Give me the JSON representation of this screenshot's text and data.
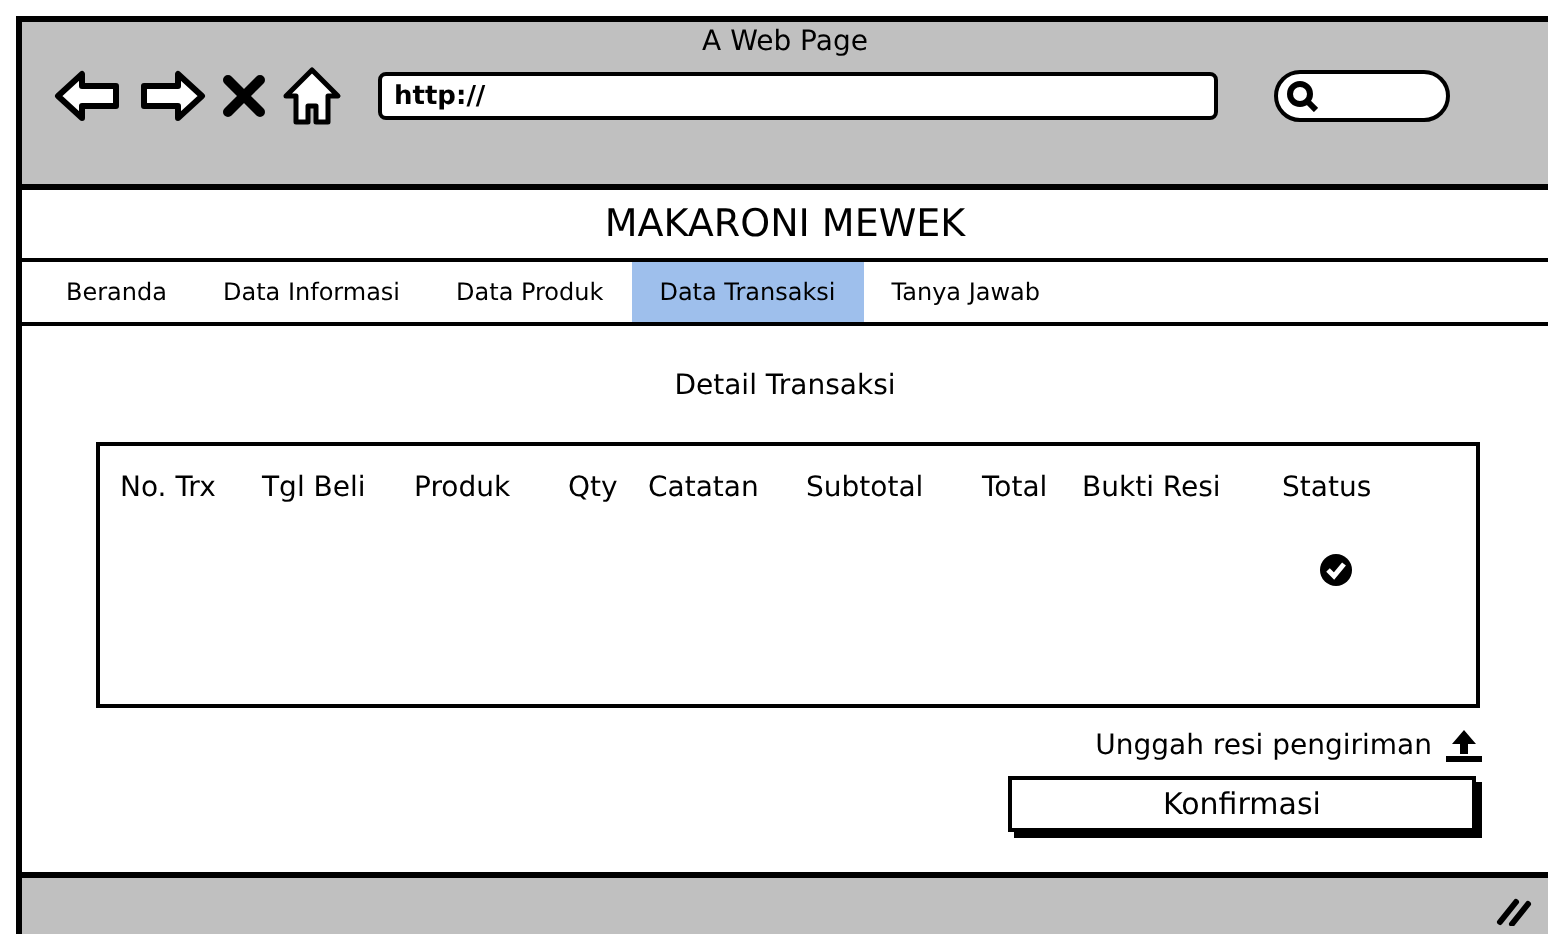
{
  "window": {
    "title": "A Web Page"
  },
  "browser": {
    "address": {
      "value": "http://"
    }
  },
  "site": {
    "title": "MAKARONI MEWEK"
  },
  "tabs": [
    {
      "label": "Beranda",
      "selected": false
    },
    {
      "label": "Data Informasi",
      "selected": false
    },
    {
      "label": "Data Produk",
      "selected": false
    },
    {
      "label": "Data Transaksi",
      "selected": true
    },
    {
      "label": "Tanya Jawab",
      "selected": false
    }
  ],
  "page": {
    "heading": "Detail Transaksi"
  },
  "table": {
    "columns": [
      "No. Trx",
      "Tgl Beli",
      "Produk",
      "Qty",
      "Catatan",
      "Subtotal",
      "Total",
      "Bukti Resi",
      "Status"
    ],
    "rows": [
      {
        "status": {
          "checked": true
        }
      }
    ]
  },
  "upload": {
    "label": "Unggah resi pengiriman"
  },
  "buttons": [
    "Konfirmasi"
  ]
}
